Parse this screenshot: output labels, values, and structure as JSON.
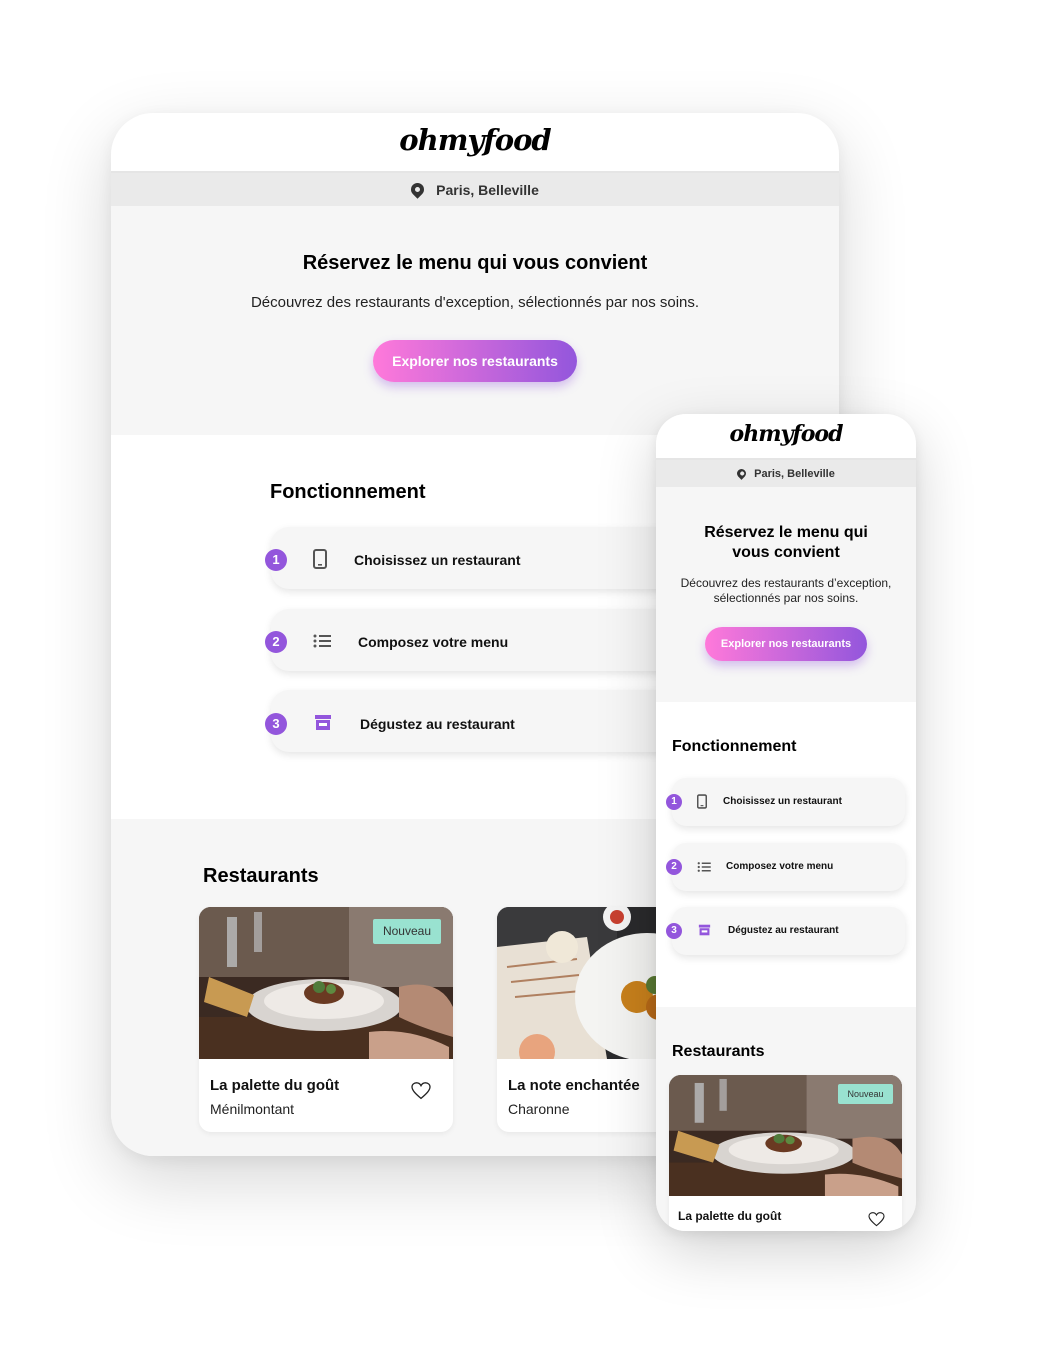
{
  "brand": {
    "logo": "ohmyfood",
    "primary": "#9356dc",
    "gradient_start": "#ff79da",
    "tag_color": "#99e2d0"
  },
  "location": {
    "icon": "map-pin-icon",
    "label": "Paris, Belleville"
  },
  "hero": {
    "title": "Réservez le menu qui vous convient",
    "subtitle": "Découvrez des restaurants d'exception, sélectionnés par nos soins.",
    "cta": "Explorer nos restaurants"
  },
  "how": {
    "title": "Fonctionnement",
    "steps": [
      {
        "number": "1",
        "icon": "smartphone-icon",
        "label": "Choisissez un restaurant"
      },
      {
        "number": "2",
        "icon": "list-icon",
        "label": "Composez votre menu"
      },
      {
        "number": "3",
        "icon": "store-icon",
        "label": "Dégustez au restaurant"
      }
    ]
  },
  "restaurants": {
    "title": "Restaurants",
    "items": [
      {
        "name": "La palette du goût",
        "location": "Ménilmontant",
        "tag": "Nouveau",
        "icon": "heart-icon"
      },
      {
        "name": "La note enchantée",
        "location": "Charonne"
      }
    ]
  },
  "mobile": {
    "hero_title": "Réservez le menu qui vous convient",
    "hero_subtitle": "Découvrez des restaurants d’exception, sélectionnés par nos soins."
  }
}
